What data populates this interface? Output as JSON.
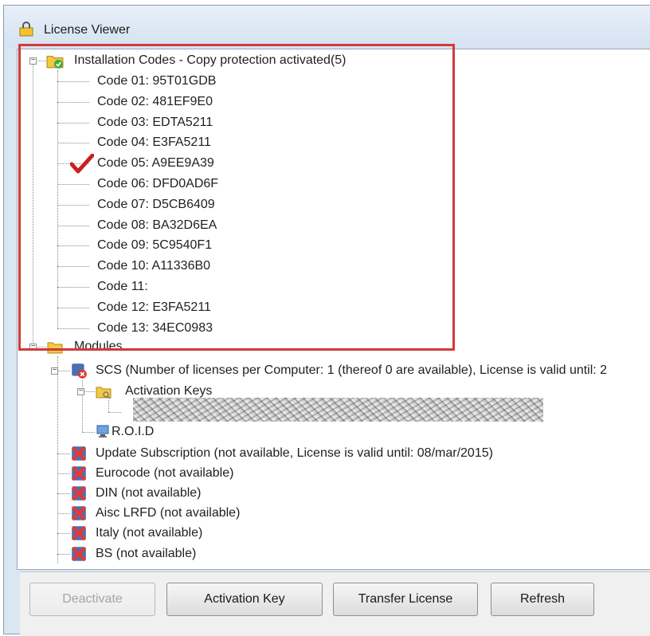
{
  "window": {
    "title": "License Viewer"
  },
  "tree": {
    "installation": {
      "label": "Installation Codes - Copy protection activated(5)",
      "codes": [
        {
          "label": "Code 01: 95T01GDB",
          "checked": false
        },
        {
          "label": "Code 02: 481EF9E0",
          "checked": false
        },
        {
          "label": "Code 03: EDTA5211",
          "checked": false
        },
        {
          "label": "Code 04: E3FA5211",
          "checked": false
        },
        {
          "label": "Code 05: A9EE9A39",
          "checked": true
        },
        {
          "label": "Code 06: DFD0AD6F",
          "checked": false
        },
        {
          "label": "Code 07: D5CB6409",
          "checked": false
        },
        {
          "label": "Code 08: BA32D6EA",
          "checked": false
        },
        {
          "label": "Code 09: 5C9540F1",
          "checked": false
        },
        {
          "label": "Code 10: A11336B0",
          "checked": false
        },
        {
          "label": "Code 11:",
          "checked": false
        },
        {
          "label": "Code 12: E3FA5211",
          "checked": false
        },
        {
          "label": "Code 13: 34EC0983",
          "checked": false
        }
      ]
    },
    "modules": {
      "label": "Modules",
      "scs": {
        "label": "SCS (Number of licenses per Computer: 1 (thereof 0 are available), License is valid until: 2",
        "activation_keys": "Activation Keys",
        "rold": "R.O.I.D"
      },
      "items": [
        "Update Subscription (not available, License is valid until: 08/mar/2015)",
        "Eurocode (not available)",
        "DIN (not available)",
        "Aisc LRFD (not available)",
        "Italy (not available)",
        "BS (not available)"
      ]
    }
  },
  "buttons": {
    "deactivate": "Deactivate",
    "activation_key": "Activation Key",
    "transfer_license": "Transfer License",
    "refresh": "Refresh"
  },
  "colors": {
    "highlight_box": "#d13a3a",
    "check": "#cc1f1f",
    "folder": "#f5c842",
    "status_ok": "#3fae3f",
    "status_error": "#e03a3a"
  }
}
